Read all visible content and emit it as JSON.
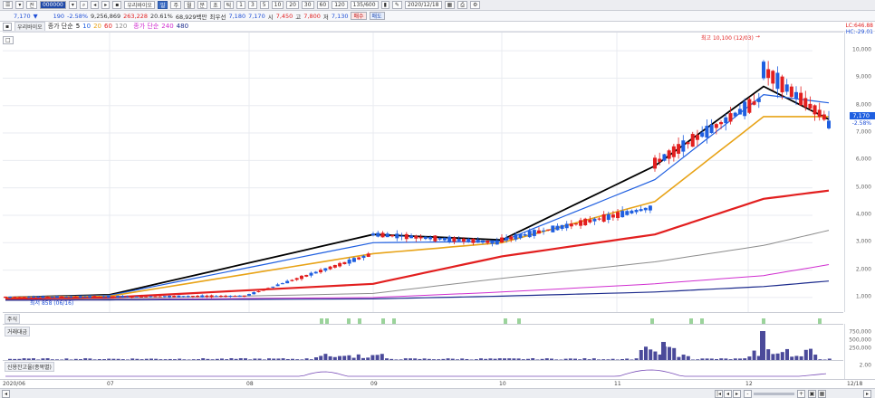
{
  "toolbar": {
    "period_label": "전",
    "code": "000000",
    "stock_name": "우리바이오",
    "period_tabs": [
      "주",
      "월",
      "분",
      "초",
      "틱"
    ],
    "minute_buttons": [
      "1",
      "3",
      "5",
      "10",
      "20",
      "30",
      "60",
      "120"
    ],
    "count": "135/600",
    "date": "2020/12/18",
    "icons": [
      "chart-type-icon",
      "tool-icon",
      "print-icon",
      "settings-icon"
    ]
  },
  "quote": {
    "price": "7,170",
    "arrow": "▼",
    "change": "190",
    "change_pct": "-2.58%",
    "volume": "9,256,869",
    "amount": "263,228",
    "turnover": "20.61%",
    "cap": "68,929백만",
    "cap_label": "최우선",
    "bid": "7,180",
    "ask": "7,170",
    "open_label": "시",
    "open": "7,450",
    "high_label": "고",
    "high": "7,800",
    "low_label": "저",
    "low": "7,130",
    "buy_button": "매수",
    "sell_button": "매도"
  },
  "legend": {
    "name_chip": "우리바이오",
    "ma_label": "종가 단순",
    "ma_periods": [
      {
        "p": "5",
        "color": "#000000"
      },
      {
        "p": "10",
        "color": "#1f5fe0"
      },
      {
        "p": "20",
        "color": "#e8a317"
      },
      {
        "p": "60",
        "color": "#e21f1f"
      },
      {
        "p": "120",
        "color": "#8c8c8c"
      }
    ],
    "ma2_label": "종가 단순",
    "ma2_periods": [
      {
        "p": "240",
        "color": "#d02fd0"
      },
      {
        "p": "480",
        "color": "#1b2a8c"
      }
    ]
  },
  "annotations": {
    "high_note": "최고 10,100 (12/03)",
    "high_arrow": "→",
    "low_note": "최저 858 (06/16)",
    "top_right_1": "LC:646.88",
    "top_right_2": "HC:-29.01",
    "last_price_box": "7,170",
    "last_pct": "-2.58%"
  },
  "y_axis": [
    "10,000",
    "9,000",
    "8,000",
    "7,000",
    "6,000",
    "5,000",
    "4,000",
    "3,000",
    "2,000",
    "1,000"
  ],
  "volume_pane": {
    "chip": "거래대금",
    "labels": [
      "750,000",
      "500,000",
      "250,000"
    ]
  },
  "credit_pane": {
    "chip": "신용잔고율(종목별)",
    "label": "2.00"
  },
  "small_pane": {
    "chip": "주식"
  },
  "x_axis": [
    "2020/06",
    "07",
    "08",
    "09",
    "10",
    "11",
    "12",
    "12/18"
  ],
  "scroll": {
    "zoom_minus": "-",
    "zoom_plus": "+",
    "icons": [
      "left-arrow-icon",
      "right-arrow-icon",
      "zoom-out-icon",
      "zoom-in-icon"
    ]
  },
  "chart_data": {
    "type": "candlestick",
    "title": "우리바이오",
    "ylim": [
      700,
      10400
    ],
    "x_range": [
      "2020/06",
      "2020/12/18"
    ],
    "candles_approx": [
      {
        "date": "2020/06",
        "open": 1000,
        "close": 1010
      },
      {
        "date": "2020/08",
        "open": 1050,
        "close": 1100
      },
      {
        "date": "2020/09",
        "open": 2600,
        "close": 3300
      },
      {
        "date": "2020/10",
        "open": 3000,
        "close": 3100
      },
      {
        "date": "2020/11",
        "open": 4300,
        "close": 5900
      },
      {
        "date": "2020/12/03",
        "open": 8300,
        "close": 9300
      },
      {
        "date": "2020/12/18",
        "open": 7450,
        "close": 7170
      }
    ],
    "series": [
      {
        "name": "5",
        "values": [
          1000,
          1100,
          3300,
          3100,
          5800,
          8700,
          7500
        ]
      },
      {
        "name": "10",
        "values": [
          1000,
          1080,
          3000,
          3050,
          5300,
          8400,
          8100
        ]
      },
      {
        "name": "20",
        "values": [
          1000,
          1050,
          2600,
          3000,
          4500,
          7600,
          7600
        ]
      },
      {
        "name": "60",
        "values": [
          950,
          1000,
          1500,
          2500,
          3300,
          4600,
          4900
        ]
      },
      {
        "name": "120",
        "values": [
          900,
          950,
          1150,
          1700,
          2300,
          2900,
          3450
        ]
      },
      {
        "name": "240",
        "values": [
          900,
          920,
          1000,
          1200,
          1500,
          1800,
          2200
        ]
      },
      {
        "name": "480",
        "values": [
          900,
          910,
          950,
          1050,
          1200,
          1400,
          1600
        ]
      }
    ]
  }
}
